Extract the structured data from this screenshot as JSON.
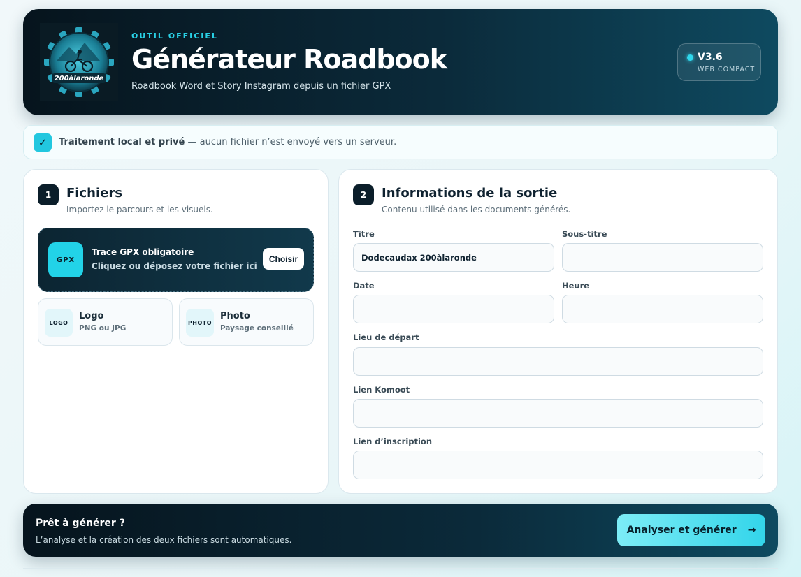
{
  "header": {
    "kicker": "OUTIL OFFICIEL",
    "title": "Générateur Roadbook",
    "subtitle": "Roadbook Word et Story Instagram depuis un fichier GPX",
    "logo_text": "200àlaronde",
    "version": "V3.6",
    "version_sub": "WEB COMPACT"
  },
  "privacy": {
    "bold": "Traitement local et privé",
    "text": " — aucun fichier n’est envoyé vers un serveur."
  },
  "files": {
    "step": "1",
    "title": "Fichiers",
    "subtitle": "Importez le parcours et les visuels.",
    "gpx": {
      "badge": "GPX",
      "line1": "Trace GPX obligatoire",
      "line2": "Cliquez ou déposez votre fichier ici",
      "button": "Choisir"
    },
    "logo": {
      "badge": "LOGO",
      "name": "Logo",
      "desc": "PNG ou JPG"
    },
    "photo": {
      "badge": "PHOTO",
      "name": "Photo",
      "desc": "Paysage conseillé"
    }
  },
  "info": {
    "step": "2",
    "title": "Informations de la sortie",
    "subtitle": "Contenu utilisé dans les documents générés.",
    "fields": {
      "titre_label": "Titre",
      "titre_value": "Dodecaudax 200àlaronde",
      "soustitre_label": "Sous-titre",
      "soustitre_value": "",
      "date_label": "Date",
      "date_value": "",
      "heure_label": "Heure",
      "heure_value": "",
      "lieu_label": "Lieu de départ",
      "lieu_value": "",
      "komoot_label": "Lien Komoot",
      "komoot_value": "",
      "inscription_label": "Lien d’inscription",
      "inscription_value": ""
    }
  },
  "footer": {
    "title": "Prêt à générer ?",
    "subtitle": "L’analyse et la création des deux fichiers sont automatiques.",
    "button": "Analyser et générer",
    "button_arrow": "→"
  },
  "colors": {
    "accent": "#22d3e8",
    "dark": "#0b1e2a"
  }
}
